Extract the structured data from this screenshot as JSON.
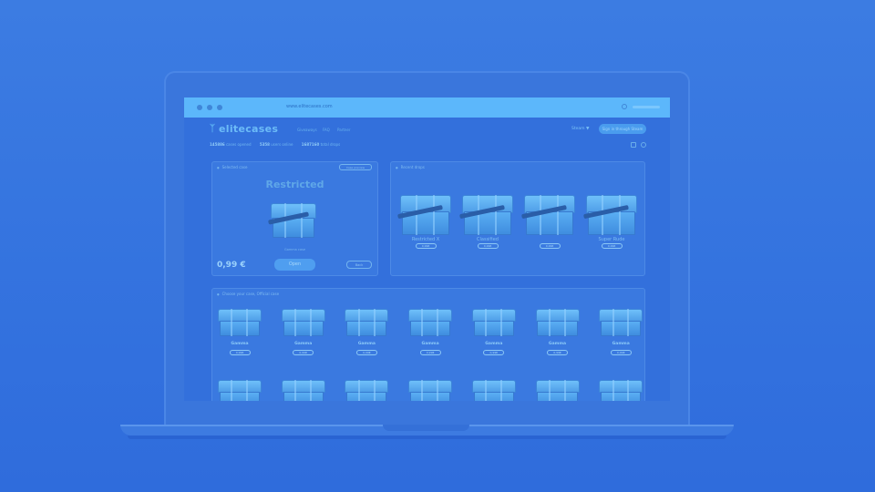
{
  "browser": {
    "url": "www.elitecases.com"
  },
  "nav": {
    "logo_text": "elitecases",
    "links": [
      "Giveaways",
      "FAQ",
      "Partner"
    ],
    "login_label": "Steam ▼",
    "cta_label": "Sign in through Steam"
  },
  "stats": [
    {
      "value": "145886",
      "label": "cases opened"
    },
    {
      "value": "5358",
      "label": "users online"
    },
    {
      "value": "1687160",
      "label": "total drops"
    }
  ],
  "selected_case": {
    "panel_title": "Selected case",
    "select_label": "Case preview",
    "rarity": "Restricted",
    "preview_label": "Gamma case",
    "price": "0,99 €",
    "open_label": "Open",
    "secondary_label": "Back"
  },
  "recent_drops": {
    "panel_title": "Recent drops",
    "items": [
      {
        "name": "Restricted X",
        "price": "0,99€"
      },
      {
        "name": "Classified",
        "price": "0,99€"
      },
      {
        "name": "",
        "price": "0,99€"
      },
      {
        "name": "Super Rude",
        "price": "0,99€"
      }
    ]
  },
  "case_grid": {
    "panel_title": "Choose your case, Official case",
    "row1": [
      {
        "name": "Gamma",
        "price": "0,99€"
      },
      {
        "name": "Gamma",
        "price": "0,99€"
      },
      {
        "name": "Gamma",
        "price": "0,99€"
      },
      {
        "name": "Gamma",
        "price": "0,99€"
      },
      {
        "name": "Gamma",
        "price": "0,99€"
      },
      {
        "name": "Gamma",
        "price": "0,99€"
      },
      {
        "name": "Gamma",
        "price": "0,99€"
      }
    ]
  },
  "colors": {
    "background": "#3574df",
    "accent": "#5cb7fb"
  }
}
